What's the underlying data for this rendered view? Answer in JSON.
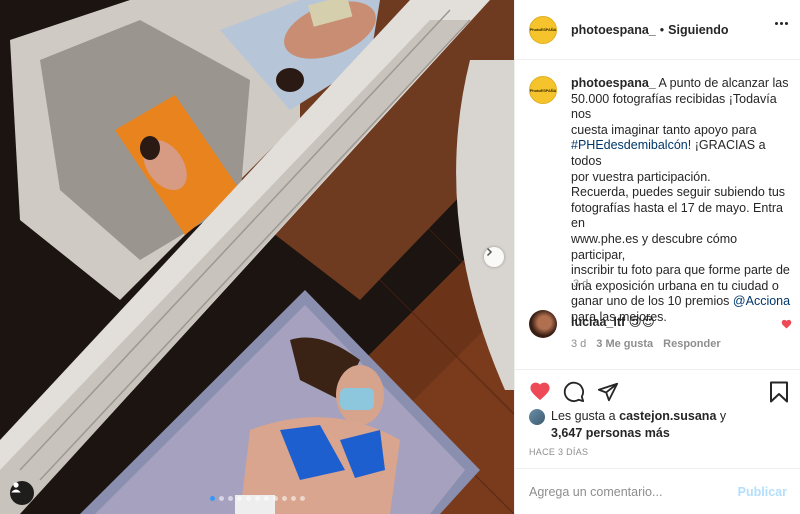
{
  "post": {
    "username": "photoespana_",
    "separator": "•",
    "follow_status": "Siguiendo",
    "avatar_text": "PhotoESPAÑA",
    "caption_lines": [
      "A punto de alcanzar las",
      "50.000 fotografías recibidas ¡Todavía nos",
      "cuesta imaginar tanto apoyo para",
      "¡GRACIAS a todos",
      "por vuestra participación.",
      "Recuerda, puedes seguir subiendo tus",
      "fotografías hasta el 17 de mayo. Entra en",
      "www.phe.es y descubre cómo participar,",
      "inscribir tu foto para que forme parte de",
      "una exposición urbana en tu ciudad o",
      "ganar uno de los 10 premios",
      "para las mejores."
    ],
    "hashtag": "#PHEdesdemibalcón!",
    "mention": "@Acciona",
    "caption_time": "3 d"
  },
  "comment": {
    "username": "luciaa_ltf",
    "text": "😍😍",
    "time": "3 d",
    "likes": "3 Me gusta",
    "reply": "Responder"
  },
  "likes": {
    "prefix": "Les gusta a",
    "user": "castejon.susana",
    "connector": "y",
    "count": "3,647 personas más"
  },
  "date": "HACE 3 DÍAS",
  "add_comment": {
    "placeholder": "Agrega un comentario...",
    "publish": "Publicar"
  },
  "carousel": {
    "total": 11,
    "active": 0
  },
  "colors": {
    "like_red": "#ed4956",
    "link": "#00376b",
    "publish_disabled": "#b2dffc"
  }
}
